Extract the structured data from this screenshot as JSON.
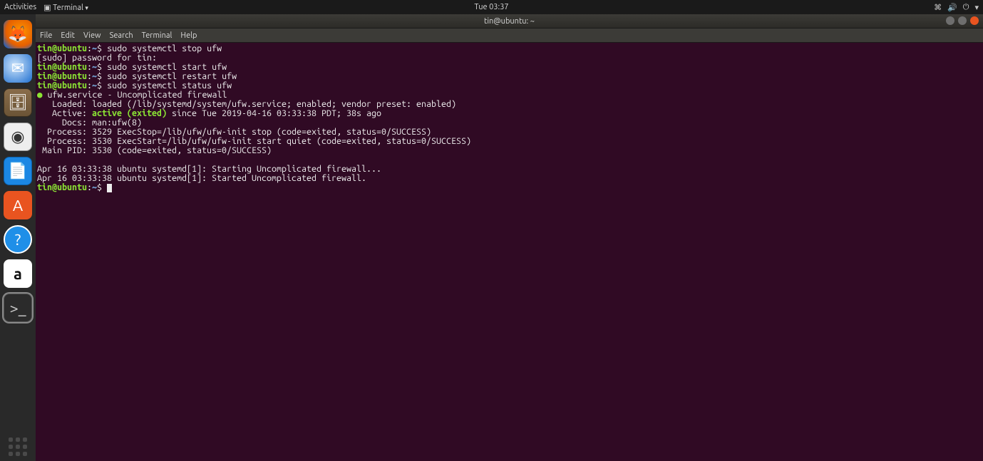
{
  "topbar": {
    "activities": "Activities",
    "app_menu": "Terminal",
    "clock": "Tue 03:37"
  },
  "dock": {
    "items": [
      {
        "name": "firefox",
        "glyph": "🦊"
      },
      {
        "name": "thunderbird",
        "glyph": "✉"
      },
      {
        "name": "files",
        "glyph": "🗄"
      },
      {
        "name": "rhythmbox",
        "glyph": "◉"
      },
      {
        "name": "libreoffice-writer",
        "glyph": "📄"
      },
      {
        "name": "ubuntu-software",
        "glyph": "A"
      },
      {
        "name": "help",
        "glyph": "?"
      },
      {
        "name": "amazon",
        "glyph": "a"
      },
      {
        "name": "terminal",
        "glyph": ">_"
      }
    ]
  },
  "window": {
    "title": "tin@ubuntu: ~"
  },
  "menubar": {
    "items": [
      "File",
      "Edit",
      "View",
      "Search",
      "Terminal",
      "Help"
    ]
  },
  "terminal": {
    "prompt_user": "tin@ubuntu",
    "prompt_path": "~",
    "lines": {
      "cmd1": "sudo systemctl stop ufw",
      "sudo_prompt": "[sudo] password for tin: ",
      "cmd2": "sudo systemctl start ufw",
      "cmd3": "sudo systemctl restart ufw",
      "cmd4": "sudo systemctl status ufw",
      "svc1": " ufw.service - Uncomplicated firewall",
      "svc2": "   Loaded: loaded (/lib/systemd/system/ufw.service; enabled; vendor preset: enabled)",
      "svc3a": "   Active: ",
      "svc3b": "active (exited)",
      "svc3c": " since Tue 2019-04-16 03:33:38 PDT; 38s ago",
      "svc4": "     Docs: man:ufw(8)",
      "svc5": "  Process: 3529 ExecStop=/lib/ufw/ufw-init stop (code=exited, status=0/SUCCESS)",
      "svc6": "  Process: 3530 ExecStart=/lib/ufw/ufw-init start quiet (code=exited, status=0/SUCCESS)",
      "svc7": " Main PID: 3530 (code=exited, status=0/SUCCESS)",
      "blank": "",
      "log1": "Apr 16 03:33:38 ubuntu systemd[1]: Starting Uncomplicated firewall...",
      "log2": "Apr 16 03:33:38 ubuntu systemd[1]: Started Uncomplicated firewall."
    }
  }
}
